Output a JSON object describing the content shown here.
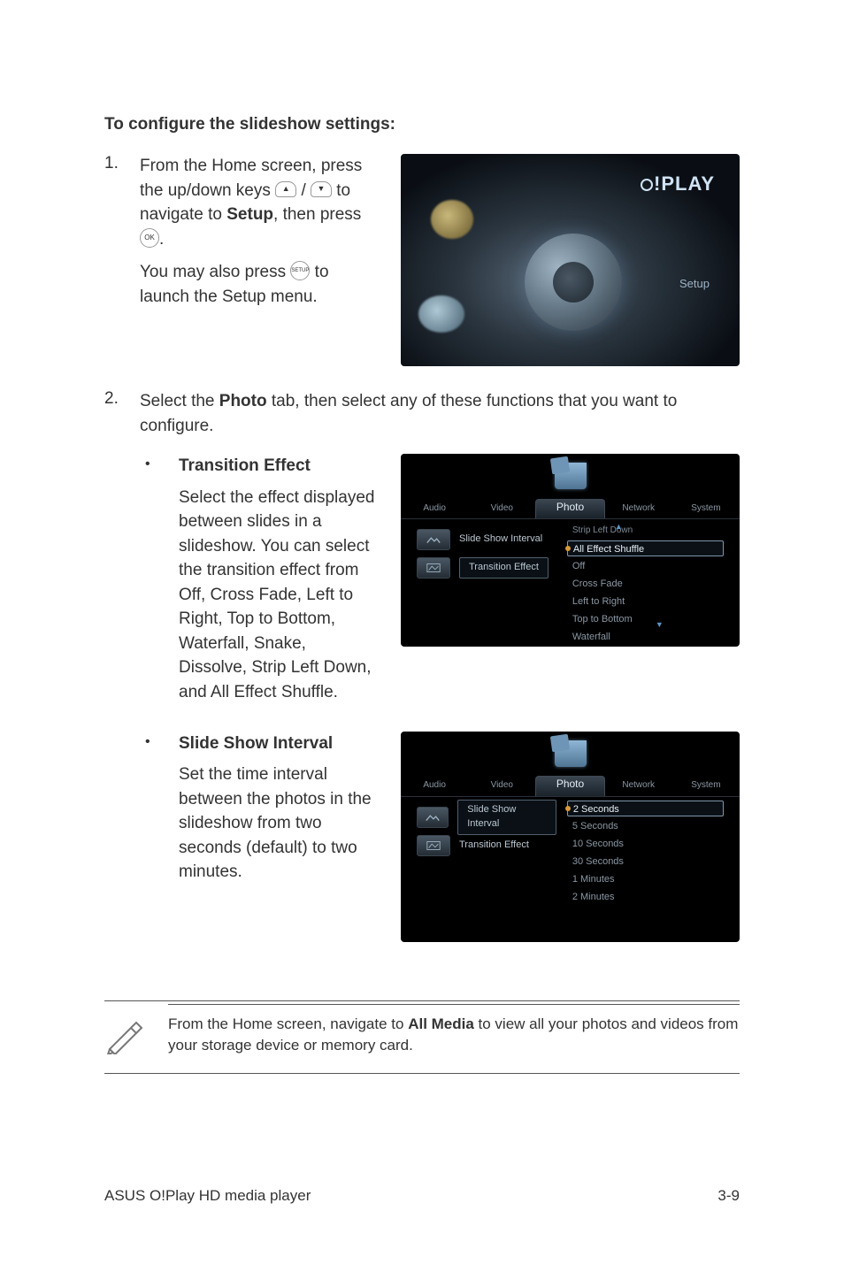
{
  "heading": "To configure the slideshow settings:",
  "steps": {
    "s1": {
      "num": "1.",
      "line1a": "From the Home screen, press the up/down keys ",
      "line1b": " / ",
      "line1c": " to navigate to ",
      "setup_word": "Setup",
      "line1d": ", then press ",
      "line1e": ".",
      "line2a": "You may also press ",
      "line2b": " to launch the Setup menu."
    },
    "s2": {
      "num": "2.",
      "line1a": "Select the ",
      "photo_word": "Photo",
      "line1b": " tab, then select any of these functions that you want to configure."
    }
  },
  "bullets": {
    "transition": {
      "title": "Transition Effect",
      "body": "Select the effect displayed between slides in a slideshow. You can select the transition effect from Off, Cross Fade, Left to Right, Top to Bottom, Waterfall, Snake, Dissolve, Strip Left Down, and All Effect Shuffle."
    },
    "interval": {
      "title": "Slide Show Interval",
      "body": "Set the time interval between the photos in the slideshow from two seconds (default) to two minutes."
    }
  },
  "setup_shot": {
    "logo": "O!PLAY",
    "label": "Setup"
  },
  "photo_shot": {
    "tabs": {
      "audio": "Audio",
      "video": "Video",
      "photo": "Photo",
      "network": "Network",
      "system": "System"
    },
    "items": {
      "interval": "Slide Show Interval",
      "effect": "Transition Effect"
    },
    "effect_opts": {
      "head": "Strip Left Down",
      "sel": "All Effect Shuffle",
      "o1": "Off",
      "o2": "Cross Fade",
      "o3": "Left to Right",
      "o4": "Top to Bottom",
      "o5": "Waterfall"
    },
    "interval_opts": {
      "sel": "2 Seconds",
      "o1": "5 Seconds",
      "o2": "10 Seconds",
      "o3": "30 Seconds",
      "o4": "1 Minutes",
      "o5": "2 Minutes"
    }
  },
  "note": {
    "a": "From the Home screen, navigate to ",
    "allmedia": "All Media",
    "b": " to view all your photos and videos from your storage device or memory card."
  },
  "footer": {
    "left": "ASUS O!Play HD media player",
    "right": "3-9"
  },
  "keys": {
    "up": "▲",
    "down": "▼",
    "ok": "OK",
    "setup": "SETUP"
  }
}
